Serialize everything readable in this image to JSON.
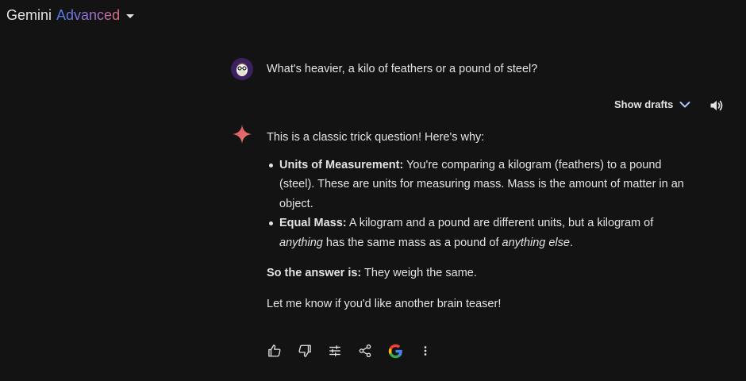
{
  "header": {
    "app_name": "Gemini",
    "tier": "Advanced"
  },
  "prompt": {
    "text": "What's heavier, a kilo of feathers or a pound of steel?"
  },
  "drafts": {
    "label": "Show drafts"
  },
  "response": {
    "intro": "This is a classic trick question! Here's why:",
    "bullets": [
      {
        "label": "Units of Measurement:",
        "text": " You're comparing a kilogram (feathers) to a pound (steel). These are units for measuring mass. Mass is the amount of matter in an object."
      },
      {
        "label": "Equal Mass:",
        "text_1": " A kilogram and a pound are different units, but a kilogram of ",
        "em_1": "anything",
        "text_2": " has the same mass as a pound of ",
        "em_2": "anything else",
        "text_3": "."
      }
    ],
    "answer_label": "So the answer is:",
    "answer_text": " They weigh the same.",
    "closing": "Let me know if you'd like another brain teaser!"
  },
  "colors": {
    "background": "#131314",
    "text": "#e3e3e3",
    "sparkle": "#e0606e",
    "google_blue": "#4285F4",
    "google_red": "#EA4335",
    "google_yellow": "#FBBC05",
    "google_green": "#34A853"
  },
  "icons": {
    "actions": [
      "thumbs-up-icon",
      "thumbs-down-icon",
      "modify-response-icon",
      "share-icon",
      "google-icon",
      "more-vert-icon"
    ]
  }
}
